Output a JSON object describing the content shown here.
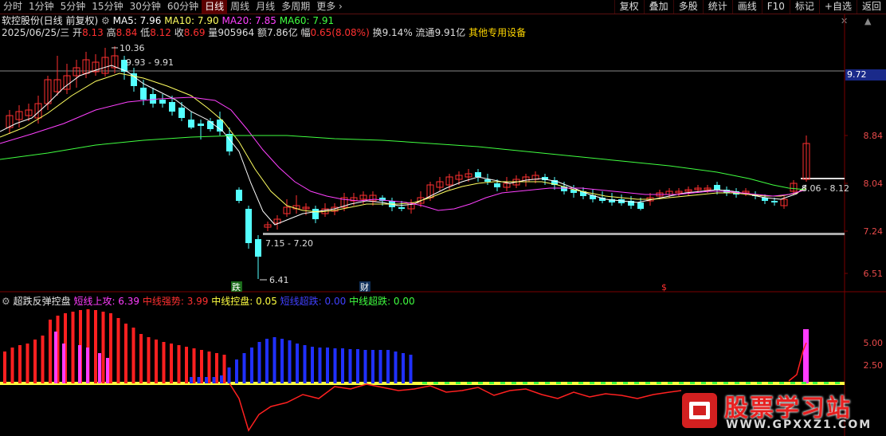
{
  "toolbar": {
    "tabs": [
      "分时",
      "1分钟",
      "5分钟",
      "15分钟",
      "30分钟",
      "60分钟",
      "日线",
      "周线",
      "月线",
      "多周期",
      "更多"
    ],
    "active_tab": "日线",
    "right_buttons": [
      "复权",
      "叠加",
      "多股",
      "统计",
      "画线",
      "F10",
      "标记",
      "+自选",
      "返回"
    ]
  },
  "title": {
    "stock": "软控股份(日线 前复权)",
    "ma5": "MA5: 7.96",
    "ma10": "MA10: 7.90",
    "ma20": "MA20: 7.85",
    "ma60": "MA60: 7.91"
  },
  "info": {
    "date": "2025/06/25/三",
    "open_label": "开",
    "open": "8.13",
    "high_label": "高",
    "high": "8.84",
    "low_label": "低",
    "low": "8.12",
    "close_label": "收",
    "close": "8.69",
    "vol_label": "量",
    "vol": "905964",
    "amt_label": "额",
    "amt": "7.86亿",
    "chg_label": "幅",
    "chg": "0.65(8.08%)",
    "turn_label": "换",
    "turn": "9.14%",
    "float_label": "流通",
    "float": "9.91亿",
    "sector": "其他专用设备"
  },
  "price_axis": [
    "9.72",
    "8.84",
    "8.04",
    "7.24",
    "6.51"
  ],
  "price_box": "9.72",
  "annotations": {
    "high_mark": "10.36",
    "range1": "9.93 - 9.91",
    "range2": "7.15 - 7.20",
    "low_mark": "6.41",
    "range3": "8.06 - 8.12",
    "tag_die": "跌",
    "tag_cai": "财",
    "tag_dollar": "$"
  },
  "indicator": {
    "name": "超跌反弹控盘",
    "items": [
      {
        "label": "短线上攻: 6.39",
        "color": "#ff3cff"
      },
      {
        "label": "中线强势: 3.99",
        "color": "#ff3030"
      },
      {
        "label": "中线控盘: 0.05",
        "color": "#ffff40"
      },
      {
        "label": "短线超跌: 0.00",
        "color": "#4040ff"
      },
      {
        "label": "中线超跌: 0.00",
        "color": "#40ff40"
      }
    ],
    "axis": [
      "5.00",
      "2.50"
    ]
  },
  "colors": {
    "up": "#ff3030",
    "down": "#54ffff",
    "ma5": "#ffffff",
    "ma10": "#ffff60",
    "ma20": "#ff40ff",
    "ma60": "#40ff40"
  },
  "watermark": {
    "title": "股票学习站",
    "url": "WWW.GPXXZ1.COM"
  }
}
